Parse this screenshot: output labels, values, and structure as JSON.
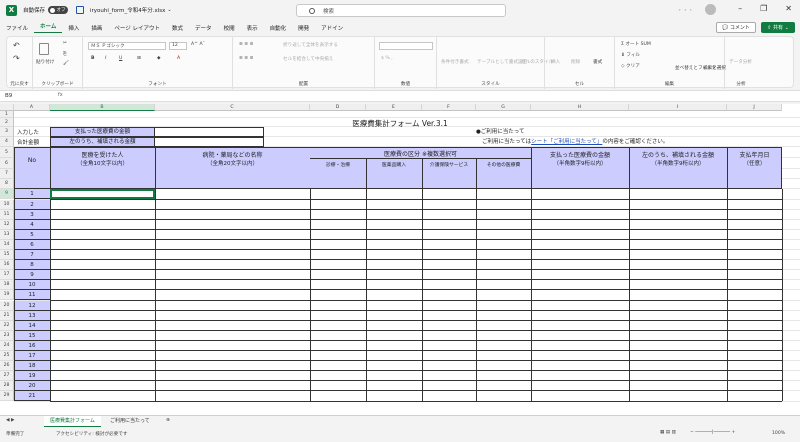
{
  "window": {
    "autosave_label": "自動保存",
    "autosave_state": "オフ",
    "filename": "iryouhi_form_令和4年分.xlsx",
    "search_placeholder": "検索",
    "user_name": "・・・",
    "accent_color": "#107c41"
  },
  "menu": [
    "ファイル",
    "ホーム",
    "挿入",
    "描画",
    "ページ レイアウト",
    "数式",
    "データ",
    "校閲",
    "表示",
    "自動化",
    "開発",
    "アドイン"
  ],
  "menu_active": 1,
  "actions": {
    "comment": "コメント",
    "share": "共有"
  },
  "ribbon": {
    "undo_label": "元に戻す",
    "paste_label": "貼り付け",
    "font_name": "ＭＳ Ｐゴシック",
    "font_size": "12",
    "wrap_text": "折り返して全体を表示する",
    "merge_center": "セルを結合して中央揃え",
    "cond_format": "条件付き書式",
    "table_format": "テーブルとして書式設定",
    "cell_style": "セルのスタイル",
    "insert": "挿入",
    "delete": "削除",
    "format": "書式",
    "autosum": "オート SUM",
    "fill": "フィル",
    "clear": "クリア",
    "sort_filter": "並べ替えとフィルター",
    "find_select": "検索と選択",
    "data_analysis": "データ分析",
    "group_labels": [
      "元に戻す",
      "クリップボード",
      "フォント",
      "配置",
      "数値",
      "スタイル",
      "セル",
      "編集",
      "分析"
    ]
  },
  "formula_bar": {
    "name_box": "B9",
    "fx": "fx",
    "content": ""
  },
  "sheet": {
    "columns": [
      "A",
      "B",
      "C",
      "D",
      "E",
      "F",
      "G",
      "H",
      "I",
      "J"
    ],
    "selected_cell": "B9",
    "title": "医療費集計フォーム  Ver.3.1",
    "row3_label": "入力した",
    "row4_label": "合計金額",
    "paid_label": "支払った医療費の金額",
    "compensated_label": "左のうち、補填される金額",
    "notice_title": "●ご利用に当たって",
    "notice_pre": "ご利用に当たってはシート「",
    "notice_link": "シート「ご利用に当たって」",
    "notice_post": "の内容をご確認ください。",
    "headers": {
      "no": "No",
      "patient": "医療を受けた人",
      "patient_sub": "（全角10文字以内）",
      "hospital": "病院・薬局などの名称",
      "hospital_sub": "（全角20文字以内）",
      "category": "医療費の区分 ※複数選択可",
      "cat1": "診療・治療",
      "cat2": "医薬品購入",
      "cat3": "介護保険サービス",
      "cat4": "その他の医療費",
      "amount": "支払った医療費の金額",
      "amount_sub": "（半角数字9桁以内）",
      "comp": "左のうち、補填される金額",
      "comp_sub": "（半角数字9桁以内）",
      "date": "支払年月日",
      "date_sub": "（任意）"
    },
    "row_numbers": [
      "1",
      "2",
      "3",
      "4",
      "5",
      "6",
      "7",
      "8",
      "9",
      "10",
      "11",
      "12",
      "13",
      "14",
      "15",
      "16",
      "17",
      "18",
      "19",
      "20",
      "21",
      "22",
      "23",
      "24",
      "25",
      "26",
      "27",
      "28",
      "29"
    ],
    "entry_numbers": [
      "1",
      "2",
      "3",
      "4",
      "5",
      "6",
      "7",
      "8",
      "9",
      "10",
      "11",
      "12",
      "13",
      "14",
      "15",
      "16",
      "17",
      "18",
      "19",
      "20",
      "21"
    ]
  },
  "tabs": [
    "医療費集計フォーム",
    "ご利用に当たって"
  ],
  "status": {
    "ready": "準備完了",
    "accessibility": "アクセシビリティ: 検討が必要です",
    "zoom": "100%"
  }
}
